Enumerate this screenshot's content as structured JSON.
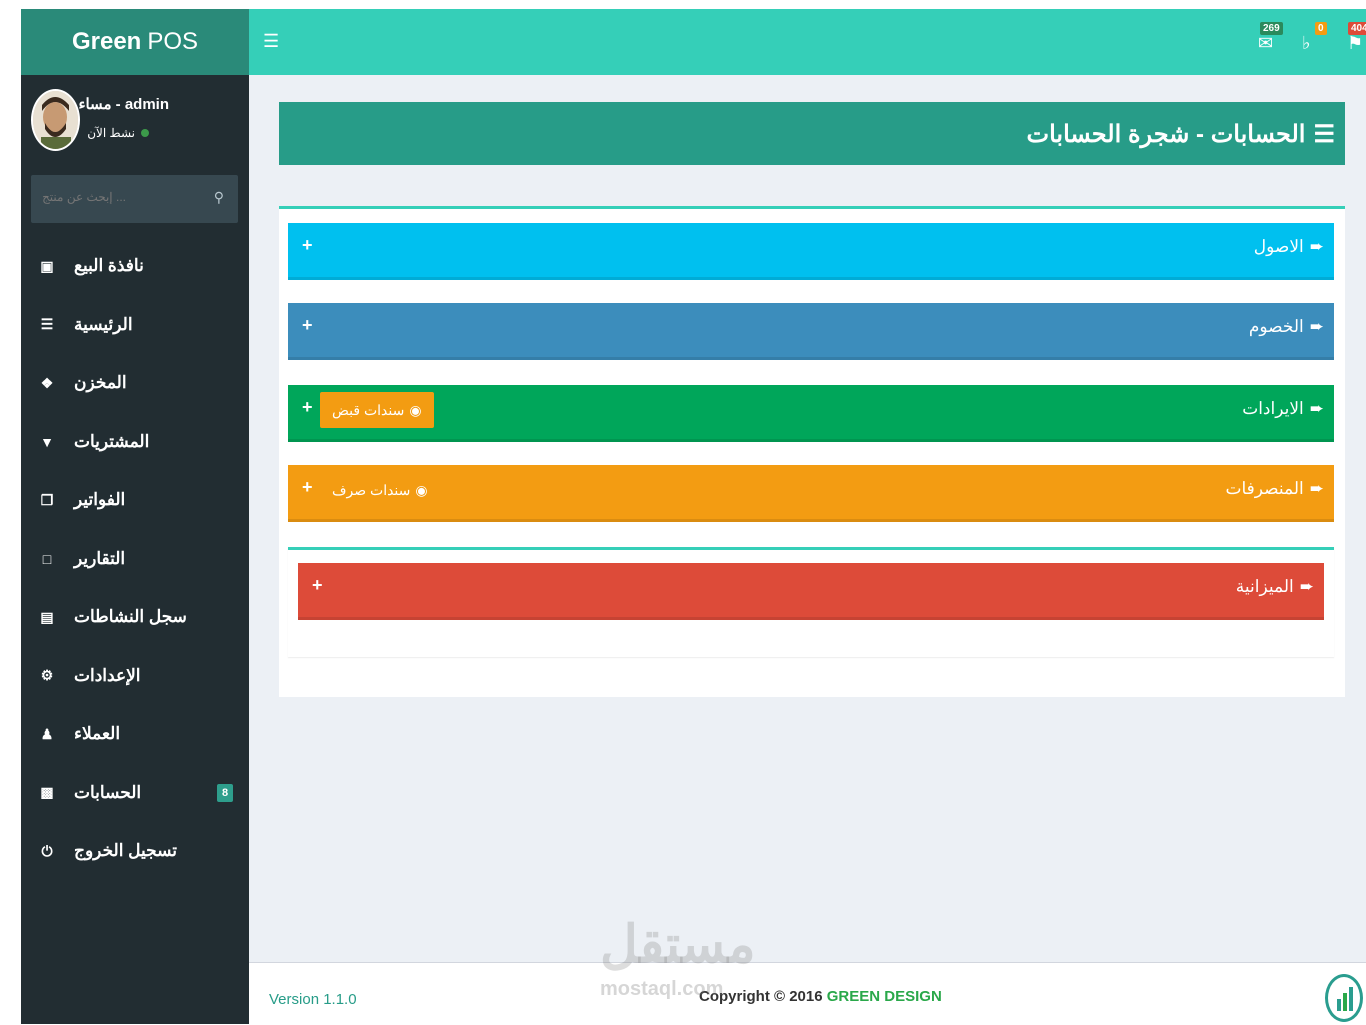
{
  "brand": {
    "bold": "Green",
    "rest": "POS"
  },
  "user": {
    "name": "مساء - admin",
    "status": "نشط الآن"
  },
  "search": {
    "placeholder": "إبحث عن منتج ..."
  },
  "sidebar": {
    "items": [
      {
        "label": "نافذة البيع",
        "icon": "cashier-icon"
      },
      {
        "label": "الرئيسية",
        "icon": "list-icon"
      },
      {
        "label": "المخزن",
        "icon": "cubes-icon"
      },
      {
        "label": "المشتريات",
        "icon": "cart-icon"
      },
      {
        "label": "الفواتير",
        "icon": "files-icon"
      },
      {
        "label": "التقارير",
        "icon": "file-icon"
      },
      {
        "label": "سجل النشاطات",
        "icon": "file-text-icon"
      },
      {
        "label": "الإعدادات",
        "icon": "gears-icon"
      },
      {
        "label": "العملاء",
        "icon": "user-icon"
      },
      {
        "label": "الحسابات",
        "icon": "money-icon",
        "badge": "8"
      },
      {
        "label": "تسجيل الخروج",
        "icon": "power-icon"
      }
    ]
  },
  "topbar": {
    "mail_count": "269",
    "notify_count": "0",
    "flag_count": "404"
  },
  "page": {
    "title": "الحسابات - شجرة الحسابات"
  },
  "accounts": [
    {
      "title": "الاصول",
      "color": "#00c0ef"
    },
    {
      "title": "الخصوم",
      "color": "#3c8dbc"
    },
    {
      "title": "الايرادات",
      "color": "#00a65a",
      "button": "سندات قبض",
      "button_color": "#f39c12"
    },
    {
      "title": "المنصرفات",
      "color": "#f39c12",
      "button": "سندات صرف",
      "button_color": "#f39c12"
    },
    {
      "title": "الميزانية",
      "color": "#dd4b39"
    }
  ],
  "footer": {
    "version": "Version 1.1.0",
    "copyright": "Copyright © 2016",
    "company": "GREEN DESIGN"
  },
  "watermark": {
    "arabic": "مستقل",
    "latin": "mostaql.com"
  }
}
